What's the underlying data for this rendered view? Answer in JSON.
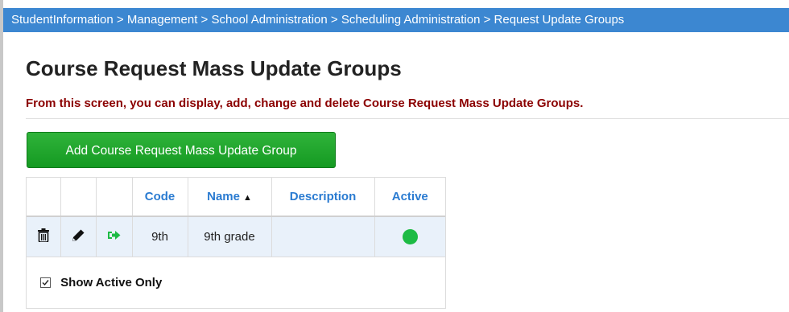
{
  "breadcrumb": {
    "text": "StudentInformation > Management > School Administration > Scheduling Administration > Request Update Groups"
  },
  "page": {
    "title": "Course Request Mass Update Groups",
    "instructions": "From this screen, you can display, add, change and delete Course Request Mass Update Groups."
  },
  "toolbar": {
    "add_label": "Add Course Request Mass Update Group"
  },
  "table": {
    "columns": {
      "code": "Code",
      "name": "Name",
      "description": "Description",
      "active": "Active"
    },
    "sort": {
      "column": "name",
      "direction": "ascending"
    },
    "rows": [
      {
        "code": "9th",
        "name": "9th grade",
        "description": "",
        "active": true
      }
    ],
    "icons": {
      "delete": "trash-icon",
      "edit": "pencil-icon",
      "open": "arrow-right-icon"
    },
    "colors": {
      "header_text": "#2a7bd1",
      "active_dot": "#1dbb44",
      "row_bg": "#e9f1fa"
    }
  },
  "filter": {
    "show_active_only_label": "Show Active Only",
    "show_active_only_checked": true
  },
  "colors": {
    "breadcrumb_bg": "#3c87d1",
    "instructions_text": "#8b0000",
    "add_button_bg": "#1fa52b"
  }
}
